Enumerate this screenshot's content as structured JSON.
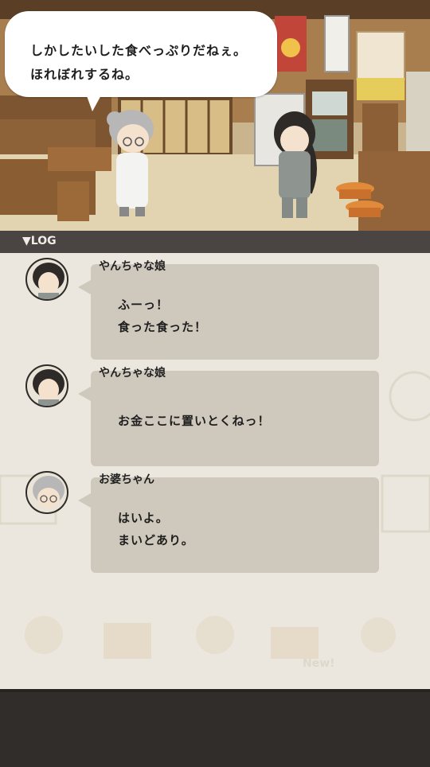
{
  "speech": {
    "lines": [
      "しかしたいした食べっぷりだねぇ。",
      "ほれぼれするね。"
    ]
  },
  "log": {
    "header": "▼LOG",
    "entries": [
      {
        "speaker": "やんちゃな娘",
        "avatar": "young-woman-avatar",
        "lines": [
          "ふーっ！",
          "食った食った！"
        ]
      },
      {
        "speaker": "やんちゃな娘",
        "avatar": "young-woman-avatar",
        "lines": [
          "お金ここに置いとくねっ！"
        ]
      },
      {
        "speaker": "お婆ちゃん",
        "avatar": "grandmother-avatar",
        "lines": [
          "はいよ。",
          "まいどあり。"
        ]
      }
    ]
  },
  "decor": {
    "new_badge": "New!"
  },
  "colors": {
    "log_header_bg": "#4a4542",
    "log_panel_bg": "#ebe7de",
    "message_bubble_bg": "#cfc9bd",
    "bottom_bar_bg": "#302d2b"
  }
}
